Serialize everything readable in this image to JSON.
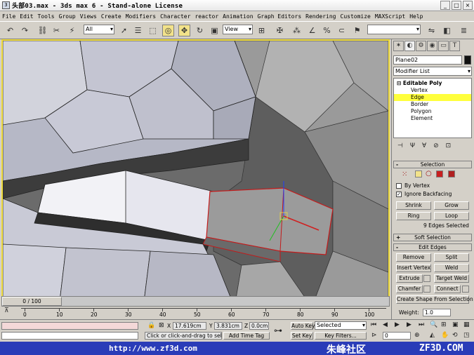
{
  "window": {
    "title": "头部03.max - 3ds max 6 - Stand-alone License",
    "app_icon": "3ds-max-icon"
  },
  "menu": [
    "File",
    "Edit",
    "Tools",
    "Group",
    "Views",
    "Create",
    "Modifiers",
    "Character",
    "reactor",
    "Animation",
    "Graph Editors",
    "Rendering",
    "Customize",
    "MAXScript",
    "Help"
  ],
  "toolbar": {
    "selection_filter": "All",
    "reference_coord": "View",
    "named_selection": ""
  },
  "command_panel": {
    "object_name": "Plane02",
    "modifier_list": "Modifier List",
    "stack": {
      "root": "Editable Poly",
      "subobjects": [
        "Vertex",
        "Edge",
        "Border",
        "Polygon",
        "Element"
      ],
      "selected": "Edge"
    },
    "selection": {
      "header": "Selection",
      "by_vertex": "By Vertex",
      "ignore_backfacing": "Ignore Backfacing",
      "by_vertex_checked": false,
      "ignore_backfacing_checked": true,
      "shrink": "Shrink",
      "grow": "Grow",
      "ring": "Ring",
      "loop": "Loop",
      "status": "9 Edges Selected"
    },
    "soft_selection": {
      "header": "Soft Selection"
    },
    "edit_edges": {
      "header": "Edit Edges",
      "remove": "Remove",
      "split": "Split",
      "insert_vertex": "Insert Vertex",
      "weld": "Weld",
      "extrude": "Extrude",
      "target_weld": "Target Weld",
      "chamfer": "Chamfer",
      "connect": "Connect",
      "create_shape": "Create Shape From Selection",
      "weight_label": "Weight:",
      "weight_value": "1.0"
    }
  },
  "timeline": {
    "slider_label": "0 / 100",
    "ruler": [
      "0",
      "10",
      "20",
      "30",
      "40",
      "50",
      "60",
      "70",
      "80",
      "90",
      "100"
    ]
  },
  "status": {
    "x_label": "X",
    "x_value": "17.619cm",
    "y_label": "Y",
    "y_value": "3.831cm",
    "z_label": "Z",
    "z_value": "0.0cm",
    "prompt": "Click or click-and-drag to select ob",
    "add_time_tag": "Add Time Tag",
    "auto_key": "Auto Key",
    "set_key": "Set Key",
    "key_mode": "Selected",
    "key_filters": "Key Filters...",
    "frame": "0"
  },
  "watermark": {
    "url": "http://www.zf3d.com",
    "brand": "朱峰社区",
    "site": "ZF3D.COM"
  }
}
